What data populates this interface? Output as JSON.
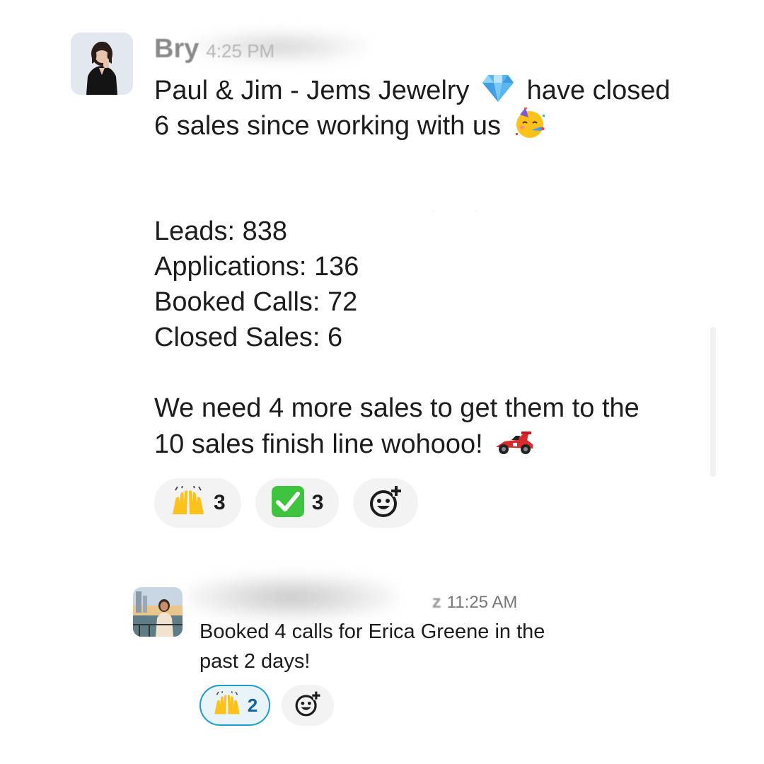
{
  "messages": [
    {
      "author": "Bry",
      "time": "4:25 PM",
      "lines": [
        {
          "before": "Paul & Jim - Jems Jewelry",
          "emoji": "gem-emoji",
          "after": "have closed"
        },
        {
          "before": "6 sales since working with us",
          "emoji": "partying-face-emoji",
          "after": ""
        }
      ],
      "stats": [
        "Leads: 838",
        "Applications: 136",
        "Booked Calls: 72",
        "Closed Sales: 6"
      ],
      "closing": [
        {
          "text": "We need 4 more sales to get them to the",
          "emoji": ""
        },
        {
          "text": "10 sales finish line wohooo!",
          "emoji": "racing-car-emoji"
        }
      ],
      "reactions": [
        {
          "emoji": "raising-hands-emoji",
          "count": "3",
          "active": false
        },
        {
          "emoji": "check-mark-button-emoji",
          "count": "3",
          "active": false
        }
      ]
    },
    {
      "author_visible_tail": "z",
      "time": "11:25 AM",
      "lines": [
        "Booked 4 calls for Erica Greene in the",
        "past 2 days!"
      ],
      "reactions": [
        {
          "emoji": "raising-hands-emoji",
          "count": "2",
          "active": true
        }
      ]
    }
  ],
  "colors": {
    "text": "#1d1c1d",
    "timestamp": "#777777",
    "pill_bg": "#f3f3f3",
    "active_border": "#1d9bd1",
    "active_count": "#1264a3"
  }
}
